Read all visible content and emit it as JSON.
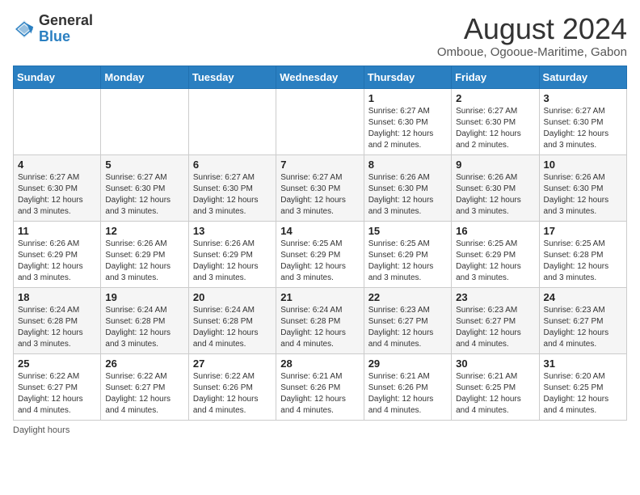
{
  "header": {
    "logo_general": "General",
    "logo_blue": "Blue",
    "month_year": "August 2024",
    "location": "Omboue, Ogooue-Maritime, Gabon"
  },
  "weekdays": [
    "Sunday",
    "Monday",
    "Tuesday",
    "Wednesday",
    "Thursday",
    "Friday",
    "Saturday"
  ],
  "weeks": [
    [
      {
        "day": "",
        "detail": ""
      },
      {
        "day": "",
        "detail": ""
      },
      {
        "day": "",
        "detail": ""
      },
      {
        "day": "",
        "detail": ""
      },
      {
        "day": "1",
        "detail": "Sunrise: 6:27 AM\nSunset: 6:30 PM\nDaylight: 12 hours and 2 minutes."
      },
      {
        "day": "2",
        "detail": "Sunrise: 6:27 AM\nSunset: 6:30 PM\nDaylight: 12 hours and 2 minutes."
      },
      {
        "day": "3",
        "detail": "Sunrise: 6:27 AM\nSunset: 6:30 PM\nDaylight: 12 hours and 3 minutes."
      }
    ],
    [
      {
        "day": "4",
        "detail": "Sunrise: 6:27 AM\nSunset: 6:30 PM\nDaylight: 12 hours and 3 minutes."
      },
      {
        "day": "5",
        "detail": "Sunrise: 6:27 AM\nSunset: 6:30 PM\nDaylight: 12 hours and 3 minutes."
      },
      {
        "day": "6",
        "detail": "Sunrise: 6:27 AM\nSunset: 6:30 PM\nDaylight: 12 hours and 3 minutes."
      },
      {
        "day": "7",
        "detail": "Sunrise: 6:27 AM\nSunset: 6:30 PM\nDaylight: 12 hours and 3 minutes."
      },
      {
        "day": "8",
        "detail": "Sunrise: 6:26 AM\nSunset: 6:30 PM\nDaylight: 12 hours and 3 minutes."
      },
      {
        "day": "9",
        "detail": "Sunrise: 6:26 AM\nSunset: 6:30 PM\nDaylight: 12 hours and 3 minutes."
      },
      {
        "day": "10",
        "detail": "Sunrise: 6:26 AM\nSunset: 6:30 PM\nDaylight: 12 hours and 3 minutes."
      }
    ],
    [
      {
        "day": "11",
        "detail": "Sunrise: 6:26 AM\nSunset: 6:29 PM\nDaylight: 12 hours and 3 minutes."
      },
      {
        "day": "12",
        "detail": "Sunrise: 6:26 AM\nSunset: 6:29 PM\nDaylight: 12 hours and 3 minutes."
      },
      {
        "day": "13",
        "detail": "Sunrise: 6:26 AM\nSunset: 6:29 PM\nDaylight: 12 hours and 3 minutes."
      },
      {
        "day": "14",
        "detail": "Sunrise: 6:25 AM\nSunset: 6:29 PM\nDaylight: 12 hours and 3 minutes."
      },
      {
        "day": "15",
        "detail": "Sunrise: 6:25 AM\nSunset: 6:29 PM\nDaylight: 12 hours and 3 minutes."
      },
      {
        "day": "16",
        "detail": "Sunrise: 6:25 AM\nSunset: 6:29 PM\nDaylight: 12 hours and 3 minutes."
      },
      {
        "day": "17",
        "detail": "Sunrise: 6:25 AM\nSunset: 6:28 PM\nDaylight: 12 hours and 3 minutes."
      }
    ],
    [
      {
        "day": "18",
        "detail": "Sunrise: 6:24 AM\nSunset: 6:28 PM\nDaylight: 12 hours and 3 minutes."
      },
      {
        "day": "19",
        "detail": "Sunrise: 6:24 AM\nSunset: 6:28 PM\nDaylight: 12 hours and 3 minutes."
      },
      {
        "day": "20",
        "detail": "Sunrise: 6:24 AM\nSunset: 6:28 PM\nDaylight: 12 hours and 4 minutes."
      },
      {
        "day": "21",
        "detail": "Sunrise: 6:24 AM\nSunset: 6:28 PM\nDaylight: 12 hours and 4 minutes."
      },
      {
        "day": "22",
        "detail": "Sunrise: 6:23 AM\nSunset: 6:27 PM\nDaylight: 12 hours and 4 minutes."
      },
      {
        "day": "23",
        "detail": "Sunrise: 6:23 AM\nSunset: 6:27 PM\nDaylight: 12 hours and 4 minutes."
      },
      {
        "day": "24",
        "detail": "Sunrise: 6:23 AM\nSunset: 6:27 PM\nDaylight: 12 hours and 4 minutes."
      }
    ],
    [
      {
        "day": "25",
        "detail": "Sunrise: 6:22 AM\nSunset: 6:27 PM\nDaylight: 12 hours and 4 minutes."
      },
      {
        "day": "26",
        "detail": "Sunrise: 6:22 AM\nSunset: 6:27 PM\nDaylight: 12 hours and 4 minutes."
      },
      {
        "day": "27",
        "detail": "Sunrise: 6:22 AM\nSunset: 6:26 PM\nDaylight: 12 hours and 4 minutes."
      },
      {
        "day": "28",
        "detail": "Sunrise: 6:21 AM\nSunset: 6:26 PM\nDaylight: 12 hours and 4 minutes."
      },
      {
        "day": "29",
        "detail": "Sunrise: 6:21 AM\nSunset: 6:26 PM\nDaylight: 12 hours and 4 minutes."
      },
      {
        "day": "30",
        "detail": "Sunrise: 6:21 AM\nSunset: 6:25 PM\nDaylight: 12 hours and 4 minutes."
      },
      {
        "day": "31",
        "detail": "Sunrise: 6:20 AM\nSunset: 6:25 PM\nDaylight: 12 hours and 4 minutes."
      }
    ]
  ],
  "footer": {
    "daylight_label": "Daylight hours"
  }
}
